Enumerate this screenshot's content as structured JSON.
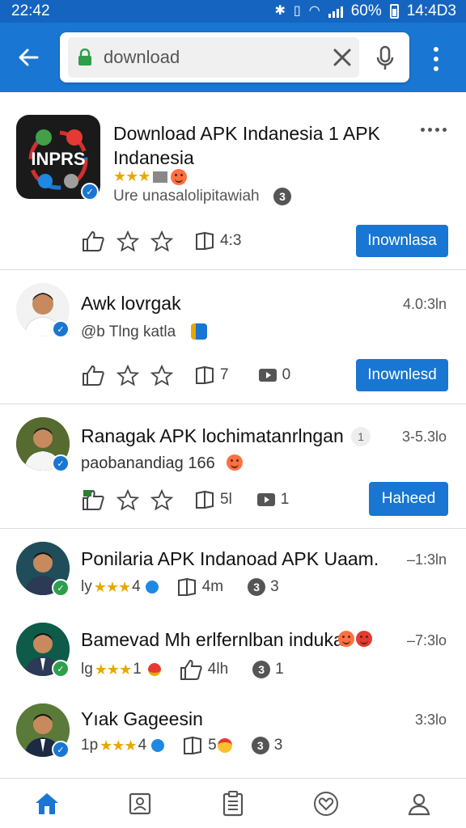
{
  "status_bar": {
    "time": "22:42",
    "battery": "60%",
    "clock_right": "14:4D3"
  },
  "search": {
    "value": "download",
    "placeholder": "download"
  },
  "items": [
    {
      "title_line1": "Download APK Indanesia 1 APK",
      "title_line2": "Indanesia",
      "sub": "Ure unasalolipitawiah",
      "sub_badge": "3",
      "count_a": "4:3",
      "button": "Inownlasa",
      "app_icon_text": "INPRS"
    },
    {
      "title": "Awk lovrgak",
      "time": "4.0:3ln",
      "sub": "@b Tlng katla",
      "count_a": "7",
      "count_b": "0",
      "button": "Inownlesd"
    },
    {
      "title": "Ranagak APK lochimatanrlngan",
      "title_badge": "1",
      "time": "3-5.3lo",
      "sub": "paobanandiag 166",
      "count_a": "5l",
      "count_b": "1",
      "button": "Haheed"
    },
    {
      "title": "Ponilaria APK Indanoad APK Uaam.",
      "time": "–1:3ln",
      "sub_prefix": "ly",
      "sub_stars": "★★★",
      "sub_num": "4",
      "count_a": "4m",
      "count_b": "3"
    },
    {
      "title": "Bamevad Mh erlfernlban induka",
      "time": "–7:3lo",
      "sub_prefix": "lg",
      "sub_stars": "★★★",
      "sub_num": "1",
      "count_a": "4lh",
      "count_b": "1"
    },
    {
      "title": "Yıak Gageesin",
      "time": "3:3lo",
      "sub_prefix": "1p",
      "sub_stars": "★★★",
      "sub_num": "4",
      "count_a": "5",
      "count_b": "3"
    }
  ],
  "top_rating": {
    "stars": "★★★"
  },
  "icons": [
    "back-arrow-icon",
    "lock-icon",
    "close-icon",
    "mic-icon",
    "more-vert-icon",
    "thumb-up-icon",
    "star-icon",
    "book-icon",
    "video-icon",
    "home-icon",
    "contacts-icon",
    "clipboard-icon",
    "heart-icon",
    "person-icon"
  ],
  "colors": {
    "primary": "#1976d2",
    "star": "#e6a800",
    "status_bar": "#1565c0"
  }
}
